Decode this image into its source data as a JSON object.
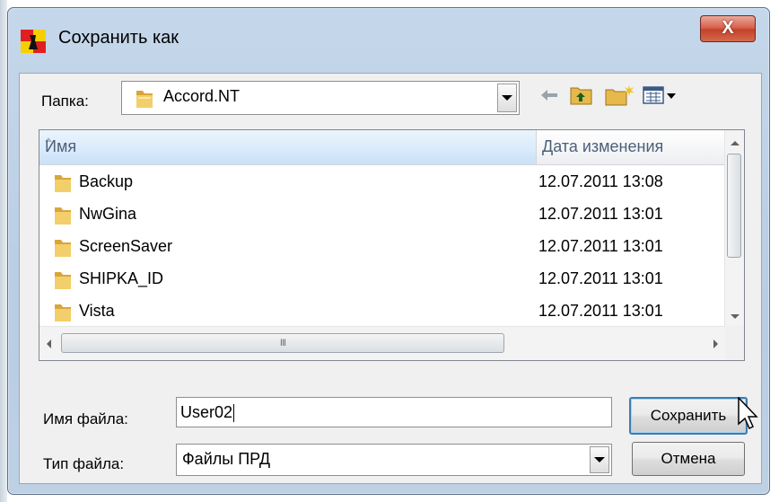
{
  "window": {
    "title": "Сохранить как",
    "close_label": "X"
  },
  "folder_row": {
    "label": "Папка:",
    "value": "Accord.NT"
  },
  "toolbar": {
    "icons": [
      "back-arrow-icon",
      "up-folder-icon",
      "new-folder-icon",
      "view-menu-icon"
    ]
  },
  "columns": {
    "name": "Имя",
    "date": "Дата изменения"
  },
  "files": [
    {
      "name": "Backup",
      "date": "12.07.2011 13:08"
    },
    {
      "name": "NwGina",
      "date": "12.07.2011 13:01"
    },
    {
      "name": "ScreenSaver",
      "date": "12.07.2011 13:01"
    },
    {
      "name": "SHIPKA_ID",
      "date": "12.07.2011 13:01"
    },
    {
      "name": "Vista",
      "date": "12.07.2011 13:01"
    }
  ],
  "scrollbar": {
    "grip": "III"
  },
  "filename": {
    "label": "Имя файла:",
    "value": "User02"
  },
  "filetype": {
    "label": "Тип файла:",
    "value": "Файлы ПРД"
  },
  "buttons": {
    "save": "Сохранить",
    "cancel": "Отмена"
  },
  "colors": {
    "accent": "#3c7fb1",
    "close": "#c4422a",
    "folder": "#e8b84a"
  }
}
